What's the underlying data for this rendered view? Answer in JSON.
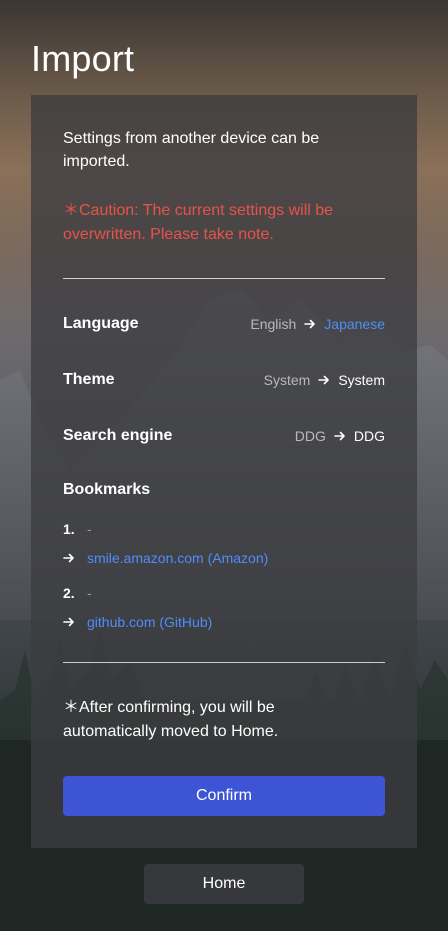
{
  "page": {
    "title": "Import"
  },
  "card": {
    "intro": "Settings from another device can be imported.",
    "caution": "＊Caution: The current settings will be overwritten. Please take note.",
    "settings": [
      {
        "label": "Language",
        "from": "English",
        "to": "Japanese",
        "changed": true
      },
      {
        "label": "Theme",
        "from": "System",
        "to": "System",
        "changed": false
      },
      {
        "label": "Search engine",
        "from": "DDG",
        "to": "DDG",
        "changed": false
      }
    ],
    "bookmarks": {
      "title": "Bookmarks",
      "items": [
        {
          "number": "1.",
          "from": "-",
          "to": "smile.amazon.com (Amazon)"
        },
        {
          "number": "2.",
          "from": "-",
          "to": "github.com (GitHub)"
        }
      ]
    },
    "note": "＊After confirming, you will be automatically moved to Home.",
    "confirm_label": "Confirm"
  },
  "home_label": "Home",
  "colors": {
    "accent": "#3d55d4",
    "link": "#4f8ef7",
    "caution": "#e5534b"
  },
  "icons": {
    "arrow": "arrow-right-icon"
  }
}
